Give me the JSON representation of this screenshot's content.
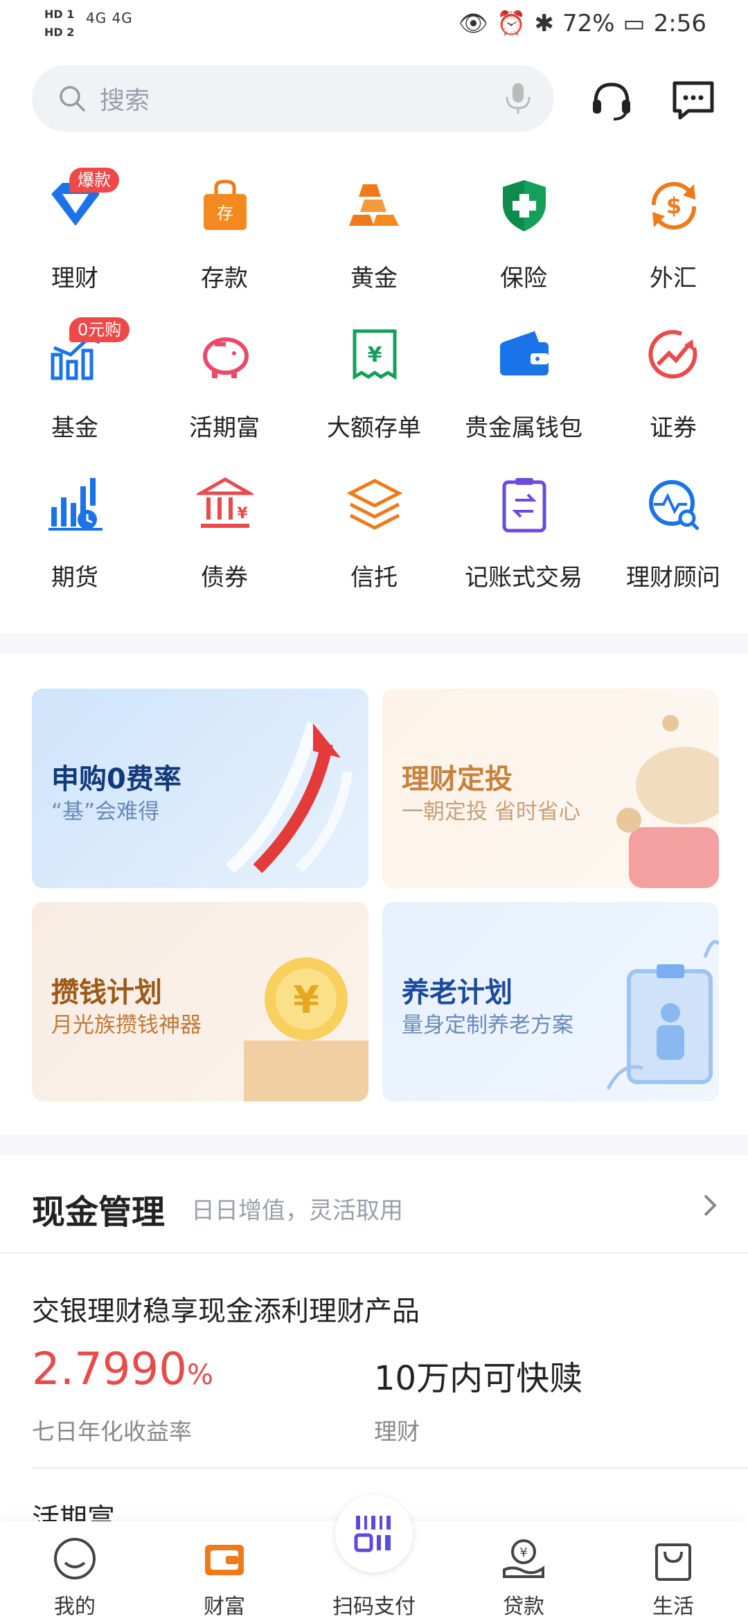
{
  "status_bar": {
    "hd1": "HD 1",
    "hd2": "HD 2",
    "signal": "4G 4G",
    "battery": "72%",
    "time": "2:56"
  },
  "search": {
    "placeholder": "搜索"
  },
  "grid": [
    {
      "label": "理财",
      "badge": "爆款",
      "icon": "diamond-icon"
    },
    {
      "label": "存款",
      "badge": "",
      "icon": "deposit-bag-icon"
    },
    {
      "label": "黄金",
      "badge": "",
      "icon": "gold-bars-icon"
    },
    {
      "label": "保险",
      "badge": "",
      "icon": "shield-icon"
    },
    {
      "label": "外汇",
      "badge": "",
      "icon": "currency-exchange-icon"
    },
    {
      "label": "基金",
      "badge": "0元购",
      "icon": "fund-chart-icon"
    },
    {
      "label": "活期富",
      "badge": "",
      "icon": "piggy-bank-icon"
    },
    {
      "label": "大额存单",
      "badge": "",
      "icon": "receipt-icon"
    },
    {
      "label": "贵金属钱包",
      "badge": "",
      "icon": "wallet-icon"
    },
    {
      "label": "证券",
      "badge": "",
      "icon": "stock-trend-icon"
    },
    {
      "label": "期货",
      "badge": "",
      "icon": "futures-chart-icon"
    },
    {
      "label": "债券",
      "badge": "",
      "icon": "bond-bank-icon"
    },
    {
      "label": "信托",
      "badge": "",
      "icon": "layers-icon"
    },
    {
      "label": "记账式交易",
      "badge": "",
      "icon": "clipboard-exchange-icon"
    },
    {
      "label": "理财顾问",
      "badge": "",
      "icon": "advisor-search-icon"
    }
  ],
  "promos": [
    {
      "title": "申购0费率",
      "subtitle": "“基”会难得"
    },
    {
      "title": "理财定投",
      "subtitle": "一朝定投 省时省心"
    },
    {
      "title": "攒钱计划",
      "subtitle": "月光族攒钱神器"
    },
    {
      "title": "养老计划",
      "subtitle": "量身定制养老方案"
    }
  ],
  "cash": {
    "heading": "现金管理",
    "subheading": "日日增值，灵活取用"
  },
  "product": {
    "name": "交银理财稳享现金添利理财产品",
    "rate": "2.7990",
    "rate_unit": "%",
    "rate_label": "七日年化收益率",
    "quick": "10万内可快赎",
    "quick_label": "理财",
    "next_name": "活期富"
  },
  "tabs": [
    {
      "label": "我的"
    },
    {
      "label": "财富"
    },
    {
      "label": "扫码支付"
    },
    {
      "label": "贷款"
    },
    {
      "label": "生活"
    }
  ],
  "colors": {
    "accent": "#f07a1a",
    "red": "#e94a4a",
    "blue": "#1a73e8"
  }
}
